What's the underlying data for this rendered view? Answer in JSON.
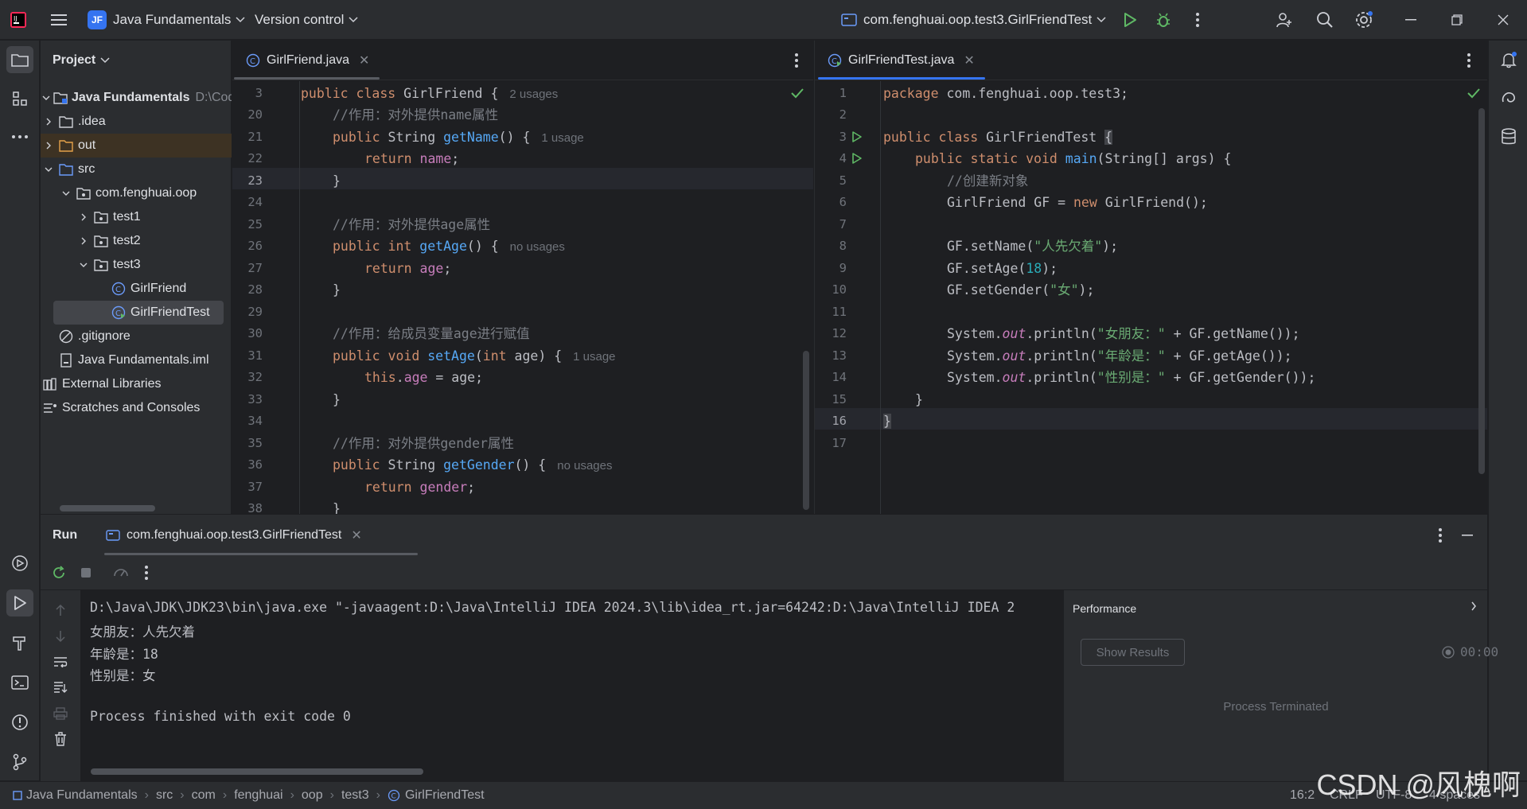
{
  "titlebar": {
    "project_badge": "JF",
    "project_name": "Java Fundamentals",
    "version_control": "Version control",
    "run_config": "com.fenghuai.oop.test3.GirlFriendTest"
  },
  "project_panel": {
    "title": "Project",
    "tree": [
      {
        "label": "Java Fundamentals",
        "path": "D:\\Code\\",
        "bold": true
      },
      {
        "label": ".idea"
      },
      {
        "label": "out"
      },
      {
        "label": "src"
      },
      {
        "label": "com.fenghuai.oop"
      },
      {
        "label": "test1"
      },
      {
        "label": "test2"
      },
      {
        "label": "test3"
      },
      {
        "label": "GirlFriend"
      },
      {
        "label": "GirlFriendTest"
      },
      {
        "label": ".gitignore"
      },
      {
        "label": "Java Fundamentals.iml"
      },
      {
        "label": "External Libraries"
      },
      {
        "label": "Scratches and Consoles"
      }
    ]
  },
  "editor_left": {
    "tab_label": "GirlFriend.java",
    "line_numbers": [
      "3",
      "20",
      "21",
      "22",
      "23",
      "24",
      "25",
      "26",
      "27",
      "28",
      "29",
      "30",
      "31",
      "32",
      "33",
      "34",
      "35",
      "36",
      "37",
      "38"
    ],
    "current_line": "23",
    "inlays": {
      "class_usages": "2 usages",
      "getName_usages": "1 usage",
      "getAge_usages": "no usages",
      "setAge_usages": "1 usage",
      "getGender_usages": "no usages"
    },
    "comments": {
      "name": "//作用：对外提供name属性",
      "age": "//作用：对外提供age属性",
      "assign": "//作用：给成员变量age进行赋值",
      "gender": "//作用：对外提供gender属性"
    },
    "tokens": {
      "public": "public",
      "class": "class",
      "classname": "GirlFriend",
      "lbrace": "{",
      "rbrace": "}",
      "String": "String",
      "int": "int",
      "void": "void",
      "return": "return",
      "this": "this",
      "getName": "getName",
      "getAge": "getAge",
      "setAge": "setAge",
      "getGender": "getGender",
      "name": "name",
      "age": "age",
      "gender": "gender",
      "parens_brace": "() {",
      "semi": ";",
      "setAge_open": "(",
      "setAge_param": " age) {",
      "dot": ".",
      "assign_rest": " = age;"
    }
  },
  "editor_right": {
    "tab_label": "GirlFriendTest.java",
    "line_numbers": [
      "1",
      "2",
      "3",
      "4",
      "5",
      "6",
      "7",
      "8",
      "9",
      "10",
      "11",
      "12",
      "13",
      "14",
      "15",
      "16",
      "17"
    ],
    "current_line": "16",
    "comments": {
      "create": "//创建新对象"
    },
    "strings": {
      "name": "\"人先欠着\"",
      "gender": "\"女\"",
      "p1": "\"女朋友：\"",
      "p2": "\"年龄是：\"",
      "p3": "\"性别是：\""
    },
    "numbers": {
      "age": "18"
    },
    "tokens": {
      "package": "package",
      "pkg": " com.fenghuai.oop.test3;",
      "public": "public",
      "class": "class",
      "classname": " GirlFriendTest ",
      "lbrace": "{",
      "rbrace": "}",
      "static": "static",
      "void": "void",
      "main": "main",
      "main_args": "(String[] args) {",
      "new_decl": "GirlFriend GF = ",
      "new": "new",
      "new_rest": " GirlFriend();",
      "setName": "GF.setName(",
      "setAge": "GF.setAge(",
      "setGender": "GF.setGender(",
      "close": ");",
      "system": "System.",
      "out": "out",
      "println": ".println(",
      "concat_name": " + GF.getName());",
      "concat_age": " + GF.getAge());",
      "concat_gender": " + GF.getGender());"
    }
  },
  "run_panel": {
    "title": "Run",
    "tab_label": "com.fenghuai.oop.test3.GirlFriendTest",
    "console": [
      "D:\\Java\\JDK\\JDK23\\bin\\java.exe \"-javaagent:D:\\Java\\IntelliJ IDEA 2024.3\\lib\\idea_rt.jar=64242:D:\\Java\\IntelliJ IDEA 2",
      "女朋友：人先欠着",
      "年龄是：18",
      "性别是：女",
      "",
      "Process finished with exit code 0"
    ],
    "performance": {
      "title": "Performance",
      "show_results": "Show Results",
      "timer": "00:00",
      "status": "Process Terminated"
    }
  },
  "statusbar": {
    "breadcrumbs": [
      "Java Fundamentals",
      "src",
      "com",
      "fenghuai",
      "oop",
      "test3",
      "GirlFriendTest"
    ],
    "position": "16:2",
    "line_sep": "CRLF",
    "encoding": "UTF-8",
    "indent": "4 spaces"
  },
  "watermark": "CSDN @风槐啊",
  "colors": {
    "accent": "#3574f0",
    "keyword": "#cf8e6d",
    "function": "#56a8f5",
    "string": "#6aab73",
    "number": "#2aacb8",
    "field": "#c77dbb",
    "run_green": "#5fb865"
  }
}
